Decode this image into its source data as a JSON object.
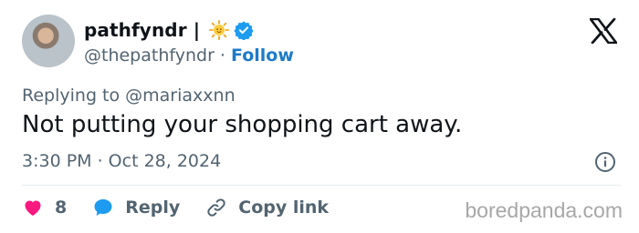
{
  "author": {
    "display_name": "pathfyndr |",
    "handle": "@thepathfyndr",
    "separator": " · ",
    "follow_label": "Follow"
  },
  "tweet": {
    "replying_prefix": "Replying to ",
    "replying_to": "@mariaxxnn",
    "text": "Not putting your shopping cart away.",
    "timestamp": "3:30 PM · Oct 28, 2024"
  },
  "actions": {
    "like_count": "8",
    "reply_label": "Reply",
    "copy_label": "Copy link"
  },
  "watermark": "boredpanda.com",
  "icons": {
    "like": "heart-icon",
    "reply": "speech-bubble-icon",
    "copy": "link-icon",
    "info": "info-icon",
    "brand": "x-logo-icon",
    "badge": "verified-badge-icon",
    "emoji": "sun-emoji-icon"
  },
  "colors": {
    "like": "#f91880",
    "reply": "#1d9bf0",
    "follow": "#1d7bc9",
    "verified": "#1d9bf0",
    "muted": "#536471"
  }
}
